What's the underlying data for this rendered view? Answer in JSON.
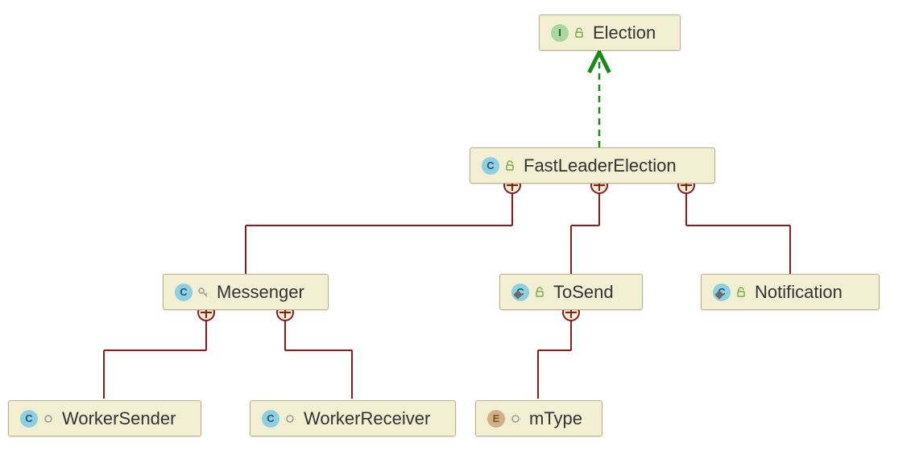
{
  "diagram": {
    "nodes": {
      "election": {
        "type": "I",
        "visibility": "public",
        "label": "Election"
      },
      "fastLeaderElection": {
        "type": "C",
        "visibility": "public",
        "label": "FastLeaderElection"
      },
      "messenger": {
        "type": "C",
        "visibility": "protected",
        "label": "Messenger"
      },
      "toSend": {
        "type": "C",
        "visibility": "public",
        "label": "ToSend",
        "static": true
      },
      "notification": {
        "type": "C",
        "visibility": "public",
        "label": "Notification",
        "static": true
      },
      "workerSender": {
        "type": "C",
        "visibility": "package",
        "label": "WorkerSender"
      },
      "workerReceiver": {
        "type": "C",
        "visibility": "package",
        "label": "WorkerReceiver"
      },
      "mType": {
        "type": "E",
        "visibility": "package",
        "label": "mType"
      }
    },
    "edges": [
      {
        "from": "fastLeaderElection",
        "to": "election",
        "kind": "implements"
      },
      {
        "from": "messenger",
        "to": "fastLeaderElection",
        "kind": "inner"
      },
      {
        "from": "toSend",
        "to": "fastLeaderElection",
        "kind": "inner"
      },
      {
        "from": "notification",
        "to": "fastLeaderElection",
        "kind": "inner"
      },
      {
        "from": "workerSender",
        "to": "messenger",
        "kind": "inner"
      },
      {
        "from": "workerReceiver",
        "to": "messenger",
        "kind": "inner"
      },
      {
        "from": "mType",
        "to": "toSend",
        "kind": "inner"
      }
    ],
    "colors": {
      "nodeFill": "#f2efd3",
      "nodeBorder": "#b8b187",
      "implementsLine": "#1a8a1a",
      "innerLine": "#8b1a1a"
    }
  }
}
